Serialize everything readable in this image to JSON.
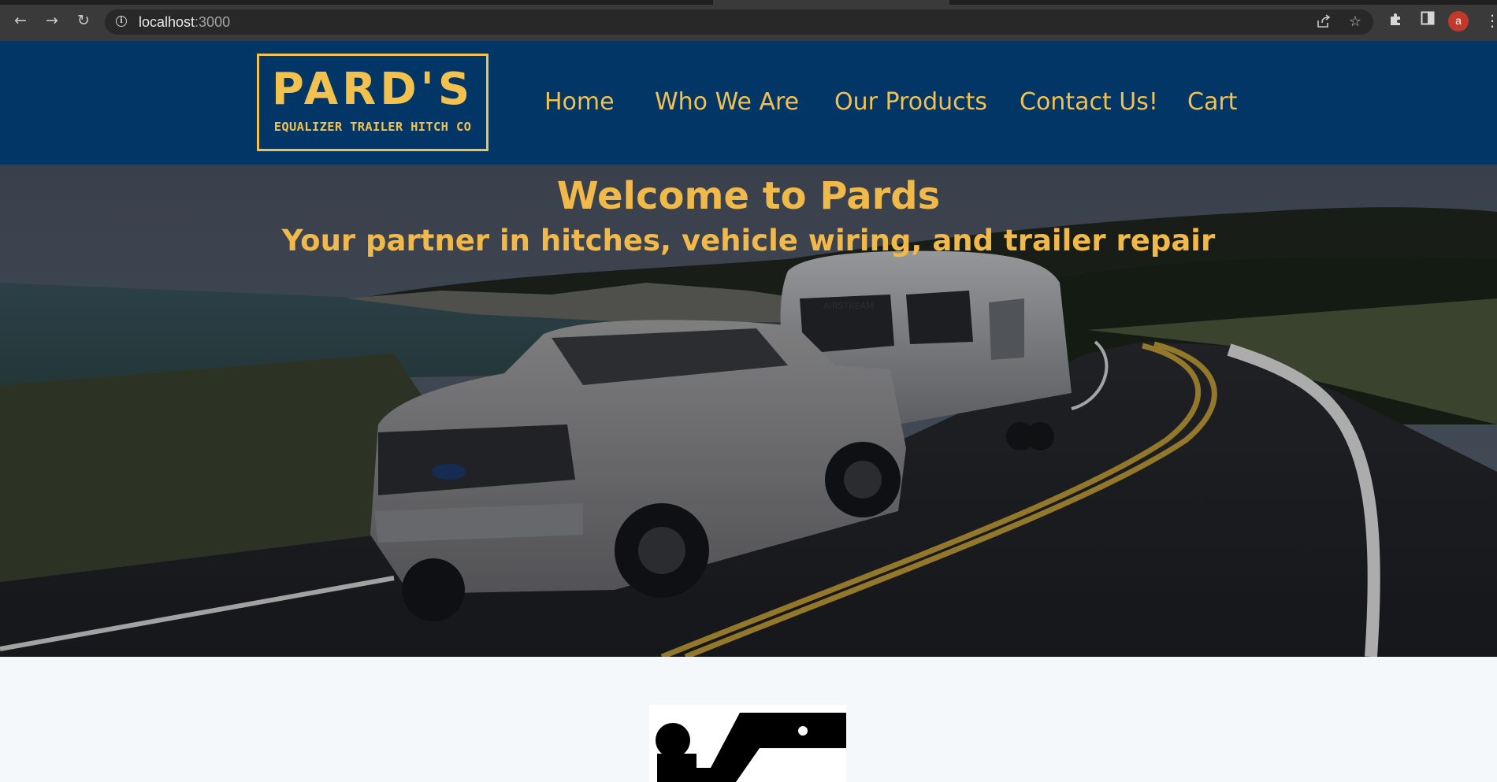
{
  "browser": {
    "url_host": "localhost",
    "url_port": ":3000",
    "avatar_initial": "a",
    "icons": [
      "back-arrow-icon",
      "forward-arrow-icon",
      "reload-icon",
      "site-info-icon",
      "share-icon",
      "bookmark-star-icon",
      "extensions-puzzle-icon",
      "side-panel-icon",
      "more-menu-icon"
    ]
  },
  "header": {
    "logo_main": "PARD'S",
    "logo_sub": "EQUALIZER TRAILER HITCH CO",
    "nav": [
      "Home",
      "Who We Are",
      "Our Products",
      "Contact Us!",
      "Cart"
    ]
  },
  "hero": {
    "title": "Welcome to Pards",
    "subtitle": "Your partner in hitches, vehicle wiring, and trailer repair",
    "trailer_label": "AIRSTREAM"
  },
  "colors": {
    "header_bg": "#023667",
    "accent": "#f2c14e",
    "page_bg": "#f4f8fb"
  },
  "content": {
    "icon": "trailer-hitch-ball-mount-icon"
  }
}
